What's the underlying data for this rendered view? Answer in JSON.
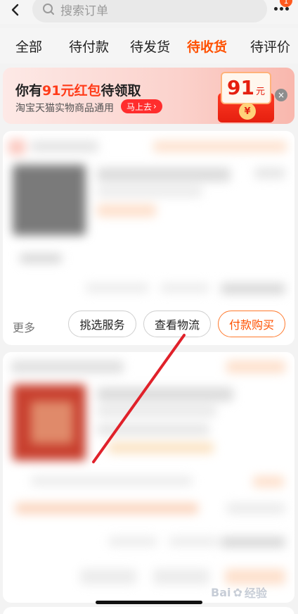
{
  "header": {
    "back_icon": "chevron-left-icon",
    "search_placeholder": "搜索订单",
    "search_icon": "search-icon",
    "more_icon": "more-dots-icon",
    "badge": "1"
  },
  "tabs": [
    {
      "label": "全部"
    },
    {
      "label": "待付款"
    },
    {
      "label": "待发货"
    },
    {
      "label": "待收货",
      "active": true
    },
    {
      "label": "待评价"
    }
  ],
  "promo": {
    "title_prefix": "你有",
    "title_highlight": "91元红包",
    "title_suffix": "待领取",
    "subtitle": "淘宝天猫实物商品通用",
    "go_label": "马上去",
    "go_arrow": "›",
    "amount": "91",
    "unit": "元",
    "coin_symbol": "¥",
    "close_symbol": "×"
  },
  "order_actions": {
    "more_label": "更多",
    "buttons": [
      {
        "label": "挑选服务"
      },
      {
        "label": "查看物流"
      },
      {
        "label": "付款购买"
      }
    ]
  },
  "watermark": {
    "text": "Bai",
    "text2": "经验",
    "paw": "✿"
  },
  "colors": {
    "accent": "#ff5000",
    "annotation_arrow": "#e0212a"
  }
}
